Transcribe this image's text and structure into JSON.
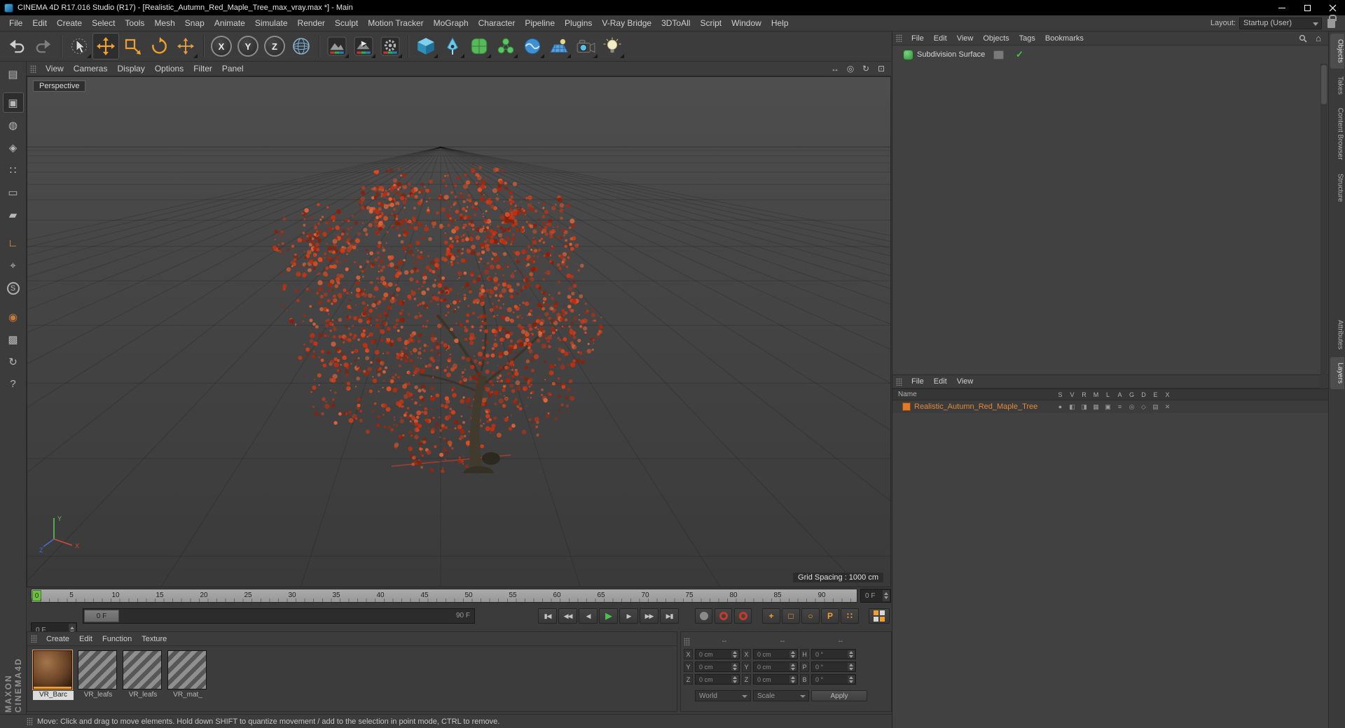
{
  "window": {
    "title": "CINEMA 4D R17.016 Studio (R17) - [Realistic_Autumn_Red_Maple_Tree_max_vray.max *] - Main"
  },
  "menubar": {
    "items": [
      "File",
      "Edit",
      "Create",
      "Select",
      "Tools",
      "Mesh",
      "Snap",
      "Animate",
      "Simulate",
      "Render",
      "Sculpt",
      "Motion Tracker",
      "MoGraph",
      "Character",
      "Pipeline",
      "Plugins",
      "V-Ray Bridge",
      "3DToAll",
      "Script",
      "Window",
      "Help"
    ],
    "layout_label": "Layout:",
    "layout_value": "Startup (User)"
  },
  "toolbar": {
    "axis_labels": [
      "X",
      "Y",
      "Z"
    ]
  },
  "palette": {
    "glyphs": [
      "▤",
      "▣",
      "◍",
      "◈",
      "∷",
      "▭",
      "▰",
      "∟",
      "⌖",
      "S",
      "◉",
      "▩",
      "↻",
      "?"
    ]
  },
  "viewport": {
    "menu": [
      "View",
      "Cameras",
      "Display",
      "Options",
      "Filter",
      "Panel"
    ],
    "nav_glyphs": [
      "↔",
      "◎",
      "↻",
      "⊡"
    ],
    "camera_label": "Perspective",
    "grid_spacing": "Grid Spacing : 1000 cm",
    "axis": {
      "x": "X",
      "y": "Y",
      "z": "Z"
    }
  },
  "timeline": {
    "marker": "0",
    "ticks": [
      "5",
      "10",
      "15",
      "20",
      "25",
      "30",
      "35",
      "40",
      "45",
      "50",
      "55",
      "60",
      "65",
      "70",
      "75",
      "80",
      "85",
      "90"
    ],
    "current_frame": "0 F",
    "slider_handle": "0 F",
    "range_end": "90 F",
    "end_frame": "90 F"
  },
  "transport": {
    "glyphs": [
      "▮◀",
      "◀◀",
      "◀",
      "▶",
      "▶",
      "▶▶",
      "▶▮"
    ]
  },
  "record": {
    "toggles": [
      "+",
      "□",
      "○",
      "P",
      "∷"
    ]
  },
  "materials": {
    "menu": [
      "Create",
      "Edit",
      "Function",
      "Texture"
    ],
    "items": [
      {
        "name": "VR_Barc"
      },
      {
        "name": "VR_leafs"
      },
      {
        "name": "VR_leafs"
      },
      {
        "name": "VR_mat_"
      }
    ]
  },
  "coordinates": {
    "headers": [
      "--",
      "--",
      "--"
    ],
    "pos_labels": [
      "X",
      "Y",
      "Z"
    ],
    "size_labels": [
      "X",
      "Y",
      "Z"
    ],
    "rot_labels": [
      "H",
      "P",
      "B"
    ],
    "pos_values": [
      "0 cm",
      "0 cm",
      "0 cm"
    ],
    "size_values": [
      "0 cm",
      "0 cm",
      "0 cm"
    ],
    "rot_values": [
      "0 °",
      "0 °",
      "0 °"
    ],
    "mode_world": "World",
    "mode_scale": "Scale",
    "apply_label": "Apply"
  },
  "object_manager": {
    "menu": [
      "File",
      "Edit",
      "View",
      "Objects",
      "Tags",
      "Bookmarks"
    ],
    "object_name": "Subdivision Surface",
    "check_glyph": "✓",
    "home_glyph": "⌂"
  },
  "layer_manager": {
    "menu": [
      "File",
      "Edit",
      "View"
    ],
    "name_header": "Name",
    "columns": [
      "S",
      "V",
      "R",
      "M",
      "L",
      "A",
      "G",
      "D",
      "E",
      "X"
    ],
    "toggle_glyphs": [
      "●",
      "◧",
      "◨",
      "▦",
      "▣",
      "≡",
      "◎",
      "◇",
      "▤",
      "✕"
    ],
    "layer_name": "Realistic_Autumn_Red_Maple_Tree"
  },
  "side_tabs": {
    "top": [
      "Objects",
      "Takes",
      "Content Browser",
      "Structure"
    ],
    "bottom": [
      "Attributes",
      "Layers"
    ]
  },
  "statusbar": {
    "text": "Move: Click and drag to move elements. Hold down SHIFT to quantize movement / add to the selection in point mode, CTRL to remove."
  },
  "branding": {
    "vertical": "MAXON CINEMA4D"
  },
  "colors": {
    "accent": "#f0a030",
    "record_red": "#c23b2e",
    "play_green": "#4cc14c",
    "marker_green": "#6fbf44",
    "layer_orange": "#e08a3c"
  }
}
